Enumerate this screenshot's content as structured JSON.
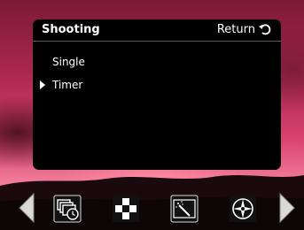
{
  "menu": {
    "title": "Shooting",
    "return_label": "Return",
    "items": [
      {
        "label": "Single"
      },
      {
        "label": "Timer"
      }
    ],
    "selected_index": 1
  },
  "toolbar": {
    "icons": [
      "previous-arrow-icon",
      "drive-mode-timer-icon",
      "checkerboard-icon",
      "magic-wand-effect-icon",
      "white-balance-compass-icon",
      "next-arrow-icon"
    ]
  }
}
